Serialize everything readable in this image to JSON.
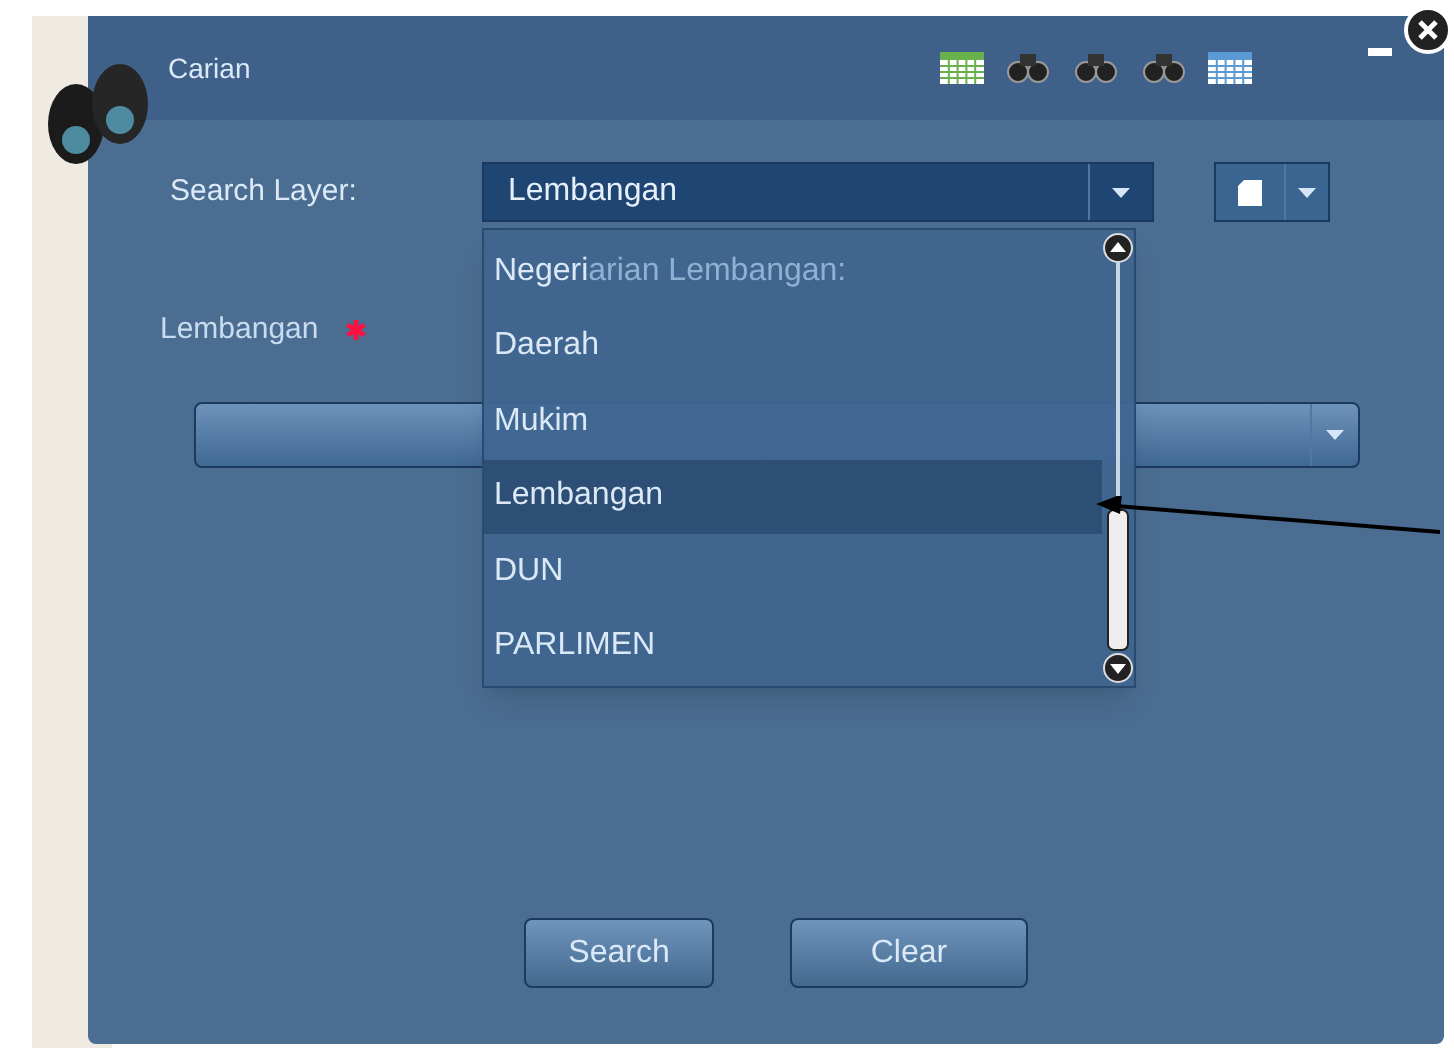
{
  "window": {
    "title": "Carian"
  },
  "search_layer": {
    "label": "Search Layer:",
    "value": "Lembangan",
    "expanded": true,
    "options": [
      {
        "label": "Negeri",
        "selected": false
      },
      {
        "label": "Daerah",
        "selected": false
      },
      {
        "label": "Mukim",
        "selected": false
      },
      {
        "label": "Lembangan",
        "selected": true
      },
      {
        "label": "DUN",
        "selected": false
      },
      {
        "label": "PARLIMEN",
        "selected": false
      }
    ]
  },
  "heading_partial": "arian Lembangan:",
  "field": {
    "label": "Lembangan",
    "required": true
  },
  "buttons": [
    {
      "label": "Search"
    },
    {
      "label": "Clear"
    }
  ]
}
